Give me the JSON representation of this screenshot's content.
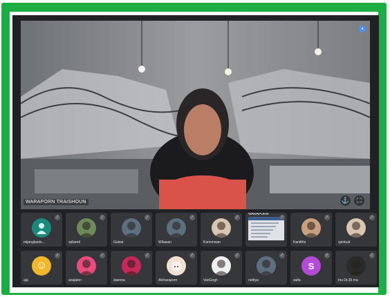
{
  "meeting": {
    "speaker_label": "WARAPORN TRAISHOUN",
    "participants": [
      {
        "label": "mijangkaolo...",
        "avatar": "person-silhouette-icon",
        "kind": "teal"
      },
      {
        "label": "spliamit",
        "avatar": "profile-photo",
        "kind": "photo2"
      },
      {
        "label": "Gulzar",
        "avatar": "profile-photo",
        "kind": "photo4"
      },
      {
        "label": "Wilawan",
        "avatar": "profile-photo",
        "kind": "photo4"
      },
      {
        "label": "Kamonwan",
        "avatar": "profile-photo",
        "kind": "photo3"
      },
      {
        "label": "WARAPORN",
        "avatar": "screen-share",
        "kind": "shot"
      },
      {
        "label": "Kanittha",
        "avatar": "profile-photo",
        "kind": "photo"
      },
      {
        "label": "spiritual",
        "avatar": "profile-photo",
        "kind": "photo3"
      },
      {
        "label": "aja",
        "avatar": "smiley-face-icon",
        "kind": "smile"
      },
      {
        "label": "anajalen",
        "avatar": "",
        "kind": "pink"
      },
      {
        "label": "duenna",
        "avatar": "",
        "kind": "red"
      },
      {
        "label": "Atcharaporn",
        "avatar": "cat-icon",
        "kind": "cat"
      },
      {
        "label": "VanGogh",
        "avatar": "profile-photo",
        "kind": "person"
      },
      {
        "label": "nettiya",
        "avatar": "profile-photo",
        "kind": "photo4"
      },
      {
        "label": "saifa",
        "avatar": "S",
        "kind": "purple"
      },
      {
        "label": "Inu Dr.35 ma",
        "avatar": "profile-photo",
        "kind": "photo5"
      }
    ]
  },
  "colors": {
    "frame": "#1cae43",
    "tile_bg": "#35373b",
    "purple_avatar": "#b44ad6",
    "pink_avatar": "#e84b7c"
  }
}
